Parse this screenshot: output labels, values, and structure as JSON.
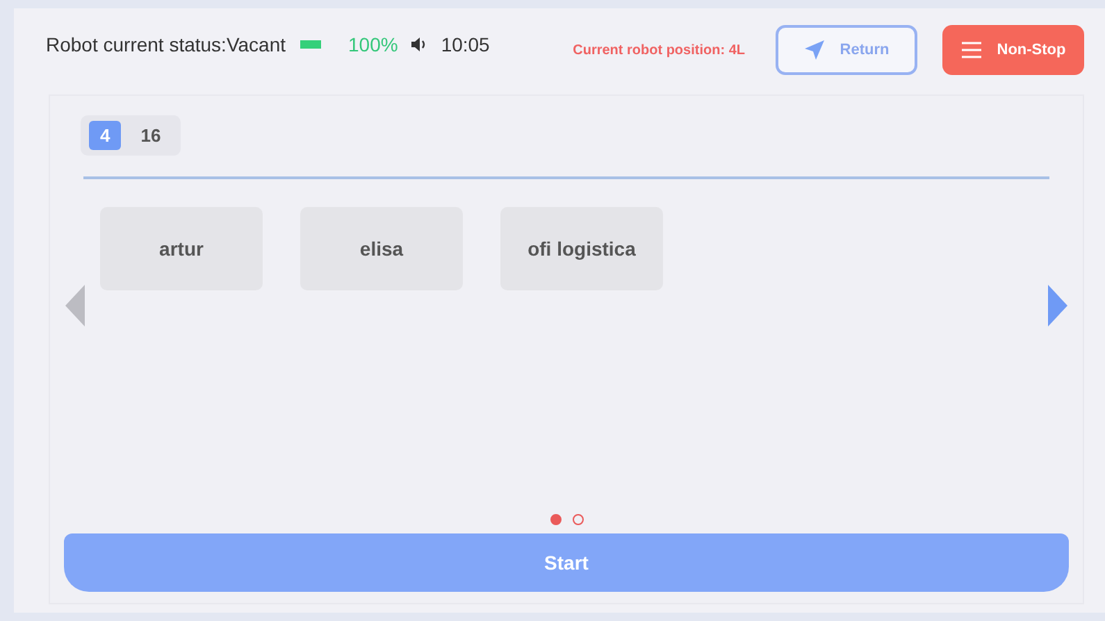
{
  "status_bar": {
    "status_text": "Robot current status:Vacant",
    "battery": "100%",
    "time": "10:05"
  },
  "position": "Current robot position: 4L",
  "buttons": [
    {
      "label": "Return",
      "kind": "outline"
    },
    {
      "label": "Non-Stop",
      "kind": "danger"
    }
  ],
  "floor_tabs": [
    {
      "label": "4",
      "selected": true
    },
    {
      "label": "16",
      "selected": false
    }
  ],
  "destinations": [
    {
      "label": "artur"
    },
    {
      "label": "elisa"
    },
    {
      "label": "ofi logistica"
    }
  ],
  "prev_arrow": {
    "disabled": true
  },
  "next_arrow": {
    "disabled": false
  },
  "pages": [
    {
      "selected": true
    },
    {
      "selected": false
    }
  ],
  "start_button": "Start"
}
